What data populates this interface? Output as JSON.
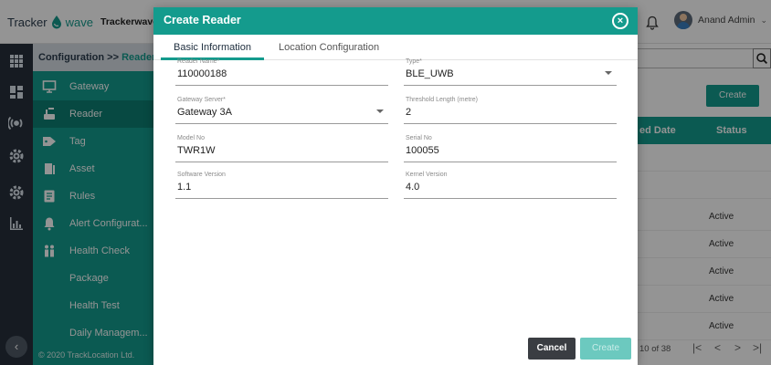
{
  "header": {
    "logo_prefix": "Tracker",
    "logo_suffix": "wave",
    "app_name": "Trackerwave P",
    "user_name": "Anand Admin",
    "user_chevron": "⌄"
  },
  "sidebar": {
    "breadcrumb_section": "Configuration",
    "breadcrumb_sep": " >> ",
    "breadcrumb_current": "Reader",
    "items": [
      {
        "label": "Gateway",
        "icon": "monitor-icon"
      },
      {
        "label": "Reader",
        "icon": "reader-icon",
        "active": true
      },
      {
        "label": "Tag",
        "icon": "tag-icon"
      },
      {
        "label": "Asset",
        "icon": "asset-icon"
      },
      {
        "label": "Rules",
        "icon": "rules-icon"
      },
      {
        "label": "Alert Configurat...",
        "icon": "bell-icon"
      },
      {
        "label": "Health Check",
        "icon": "people-icon"
      },
      {
        "label": "Package"
      },
      {
        "label": "Health Test"
      },
      {
        "label": "Daily Managem..."
      }
    ],
    "copyright": "© 2020 TrackLocation Ltd.",
    "back_glyph": "‹"
  },
  "background_page": {
    "create_label": "Create",
    "col_date": "ed Date",
    "col_status": "Status",
    "rows": [
      "Active",
      "Active",
      "Active",
      "Active",
      "Active"
    ],
    "pagination": "10 of 38",
    "pager_first": "|<",
    "pager_prev": "<",
    "pager_next": ">",
    "pager_last": ">|"
  },
  "modal": {
    "title": "Create Reader",
    "close_glyph": "×",
    "tabs": [
      {
        "label": "Basic Information",
        "active": true
      },
      {
        "label": "Location Configuration",
        "active": false
      }
    ],
    "fields": {
      "reader_name": {
        "label": "Reader Name*",
        "value": "110000188"
      },
      "type": {
        "label": "Type*",
        "value": "BLE_UWB"
      },
      "gateway_server": {
        "label": "Gateway Server*",
        "value": "Gateway 3A"
      },
      "threshold_length": {
        "label": "Threshold Length (metre)",
        "value": "2"
      },
      "model_no": {
        "label": "Model No",
        "value": "TWR1W"
      },
      "serial_no": {
        "label": "Serial No",
        "value": "100055"
      },
      "software_version": {
        "label": "Software Version",
        "value": "1.1"
      },
      "kernel_version": {
        "label": "Kernel Version",
        "value": "4.0"
      }
    },
    "cancel_label": "Cancel",
    "create_label": "Create"
  },
  "colors": {
    "accent": "#149b8d",
    "rail": "#262f3b",
    "cancel": "#3a3d42"
  }
}
